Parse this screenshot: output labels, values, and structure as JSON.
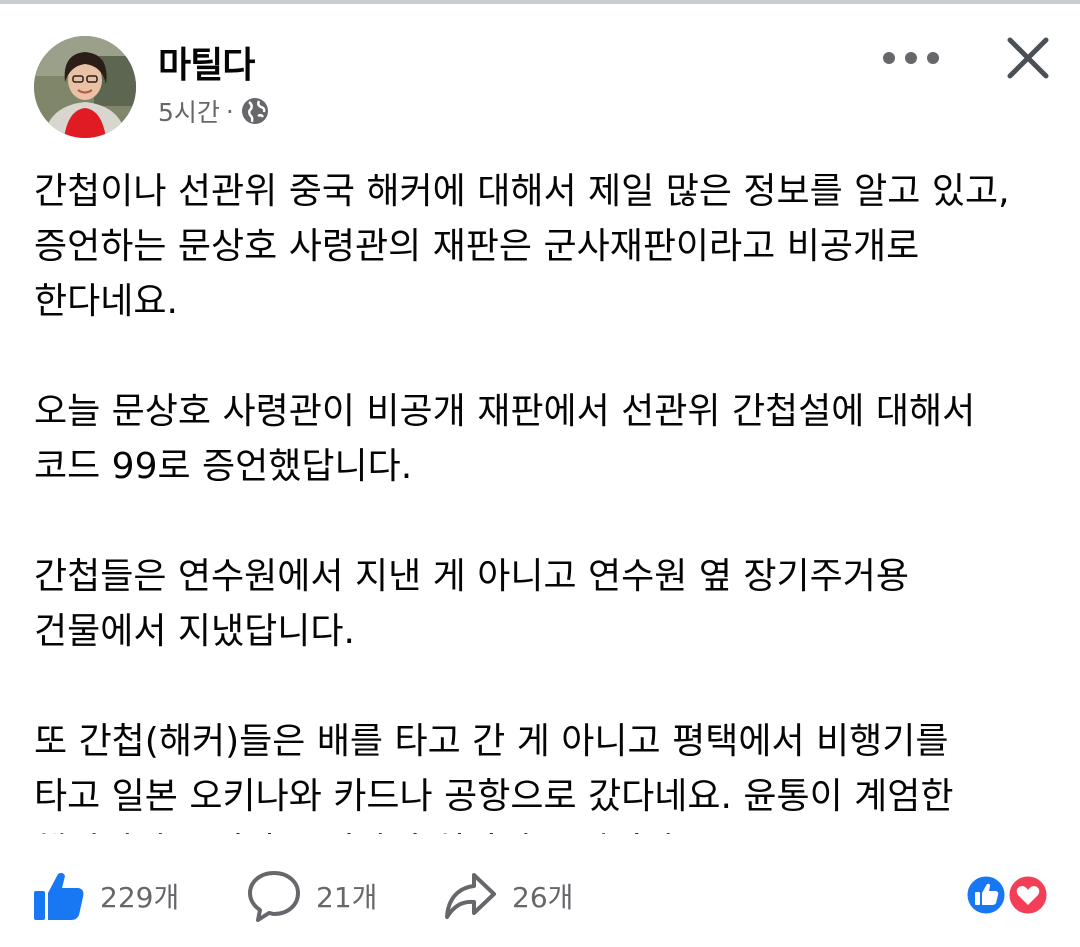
{
  "post": {
    "author": "마틸다",
    "time": "5시간",
    "separator": "·",
    "paragraphs": [
      "간첩이나 선관위 중국 해커에 대해서 제일 많은 정보를 알고 있고,\n증언하는 문상호 사령관의 재판은 군사재판이라고 비공개로\n한다네요.",
      "오늘 문상호 사령관이 비공개 재판에서 선관위 간첩설에 대해서\n코드 99로 증언했답니다.",
      "간첩들은 연수원에서 지낸 게 아니고 연수원 옆 장기주거용\n건물에서 지냈답니다.",
      "또 간첩(해커)들은 배를 타고 간 게 아니고 평택에서 비행기를\n타고 일본 오키나와 카드나 공항으로 갔다네요. 윤통이 계엄한\n핵심적인 동기가 드러나니 희망이 보입니다."
    ]
  },
  "actions": {
    "like_count": "229개",
    "comment_count": "21개",
    "share_count": "26개"
  },
  "icons": {
    "privacy": "globe-icon",
    "menu": "more-icon",
    "close": "close-icon",
    "like": "thumbs-up-icon",
    "comment": "comment-bubble-icon",
    "share": "share-arrow-icon",
    "reactions": [
      "like-reaction-icon",
      "love-reaction-icon"
    ]
  },
  "colors": {
    "like_blue": "#1877f2",
    "love_red": "#f33e58",
    "secondary_text": "#65676b"
  }
}
